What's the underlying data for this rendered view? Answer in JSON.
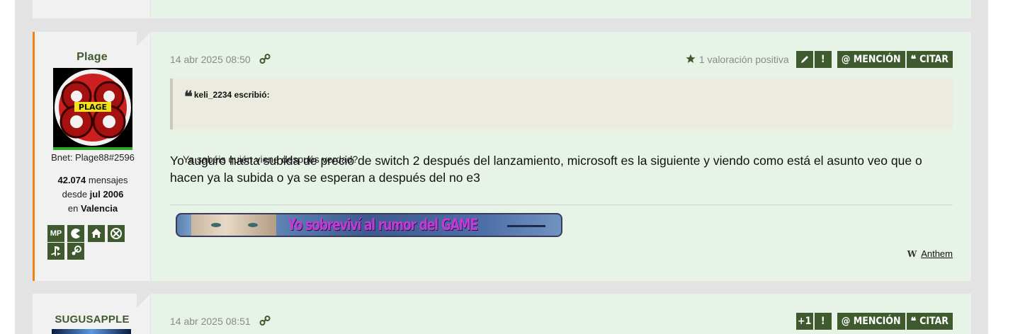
{
  "posts": [
    {
      "username": "Plage",
      "avatar_text": "PLAGE",
      "bnet": "Bnet: Plage88#2596",
      "messages_count": "42.074",
      "messages_label": "mensajes",
      "since_label": "desde",
      "since_value": "jul 2006",
      "location_label": "en",
      "location_value": "Valencia",
      "profile_icons": [
        "MP",
        "pacman-icon",
        "home-icon",
        "xbox-icon",
        "playstation-icon",
        "steam-icon"
      ],
      "timestamp": "14 abr 2025 08:50",
      "rating_text": "1 valoración positiva",
      "buttons": {
        "mention": "@ MENCIÓN",
        "quote": "CITAR",
        "report": "!"
      },
      "quote": {
        "author": "keli_2234 escribió:",
        "text": "Ya sabéis quién viene después verdad?"
      },
      "body": "Yo auguro hasta subida de precio de switch 2 después del lanzamiento, microsoft es la siguiente y viendo como está el asunto veo que o hacen ya la subida o ya se esperan a después del no e3",
      "signature_banner_text": "Yo sobreviví al rumor del GAME",
      "signature_link": "Anthem",
      "signature_link_prefix": "W"
    },
    {
      "username": "SUGUSAPPLE",
      "timestamp": "14 abr 2025 08:51",
      "buttons": {
        "plus_one": "+1",
        "report": "!",
        "mention": "@ MENCIÓN",
        "quote": "CITAR"
      }
    }
  ],
  "colors": {
    "accent": "#f0830f",
    "button": "#3e5a2e",
    "post_bg": "#e8f3e8",
    "sidebar_bg": "#f1f1f1"
  }
}
